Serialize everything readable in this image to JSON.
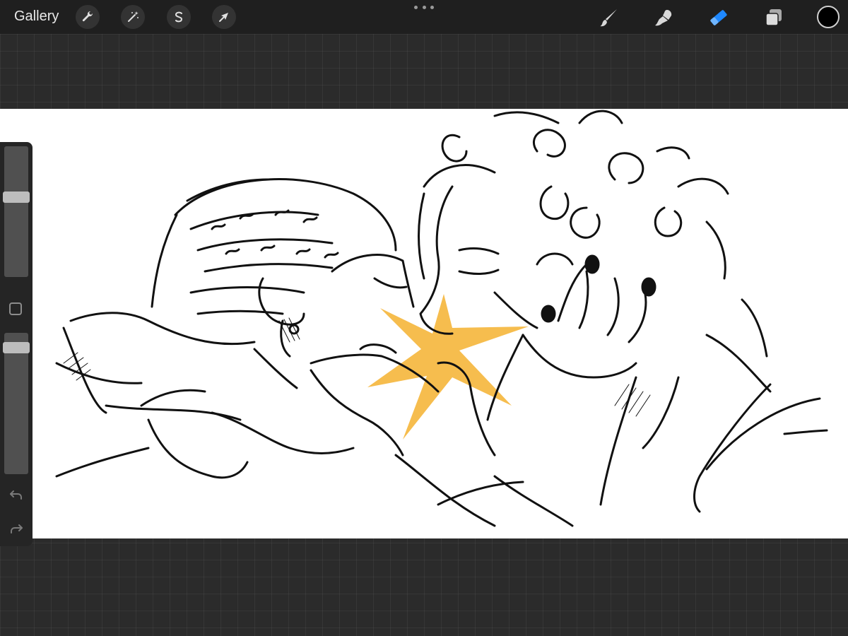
{
  "app": {
    "gallery_label": "Gallery"
  },
  "toolbar": {
    "left_tools": [
      {
        "name": "actions",
        "icon": "wrench-icon"
      },
      {
        "name": "adjustments",
        "icon": "magic-wand-icon"
      },
      {
        "name": "selection",
        "icon": "selection-s-icon"
      },
      {
        "name": "transform",
        "icon": "arrow-cursor-icon"
      }
    ],
    "right_tools": [
      {
        "name": "brush",
        "icon": "brush-icon",
        "active": false
      },
      {
        "name": "smudge",
        "icon": "smudge-icon",
        "active": false
      },
      {
        "name": "eraser",
        "icon": "eraser-icon",
        "active": true
      },
      {
        "name": "layers",
        "icon": "layers-icon",
        "active": false
      }
    ],
    "current_color": "#000000",
    "active_tool_color": "#1e88ff"
  },
  "sidebar": {
    "brush_size_level": 0.62,
    "opacity_level": 0.93
  },
  "colors": {
    "background": "#2b2b2b",
    "canvas": "#ffffff",
    "highlight": "#f6bd4e"
  }
}
